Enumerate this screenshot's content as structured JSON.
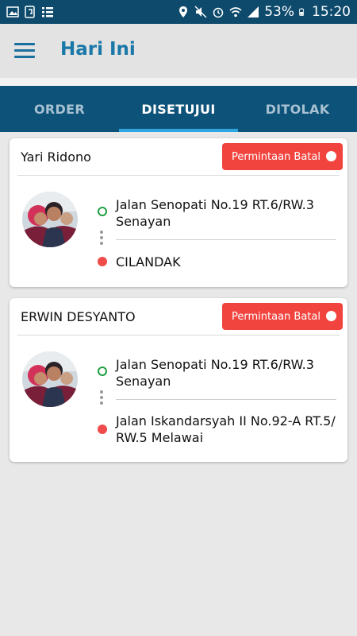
{
  "status_bar": {
    "battery": "53%",
    "time": "15:20",
    "left_icons": [
      "image-icon",
      "nfc-icon",
      "list-icon"
    ],
    "right_icons": [
      "location-icon",
      "mute-icon",
      "alarm-icon",
      "wifi-icon",
      "signal-icon",
      "battery-icon"
    ]
  },
  "appbar": {
    "title": "Hari Ini"
  },
  "tabs": [
    {
      "label": "ORDER",
      "active": false
    },
    {
      "label": "DISETUJUI",
      "active": true
    },
    {
      "label": "DITOLAK",
      "active": false
    }
  ],
  "orders": [
    {
      "name": "Yari  Ridono",
      "status_button": "Permintaan Batal",
      "origin": "Jalan Senopati No.19 RT.6/RW.3 Senayan",
      "destination": "CILANDAK"
    },
    {
      "name": "ERWIN DESYANTO",
      "status_button": "Permintaan Batal",
      "origin": "Jalan Senopati No.19 RT.6/RW.3 Senayan",
      "destination": "Jalan Iskandarsyah II No.92-A RT.5/ RW.5 Melawai"
    }
  ],
  "colors": {
    "primary_dark": "#0d4a6c",
    "tab_bar": "#0d5278",
    "accent_title": "#1a78a8",
    "tab_indicator": "#2fa6e0",
    "cancel_button": "#f2443f",
    "origin_pin": "#1e9e3e",
    "destination_pin": "#ef4b4b"
  }
}
